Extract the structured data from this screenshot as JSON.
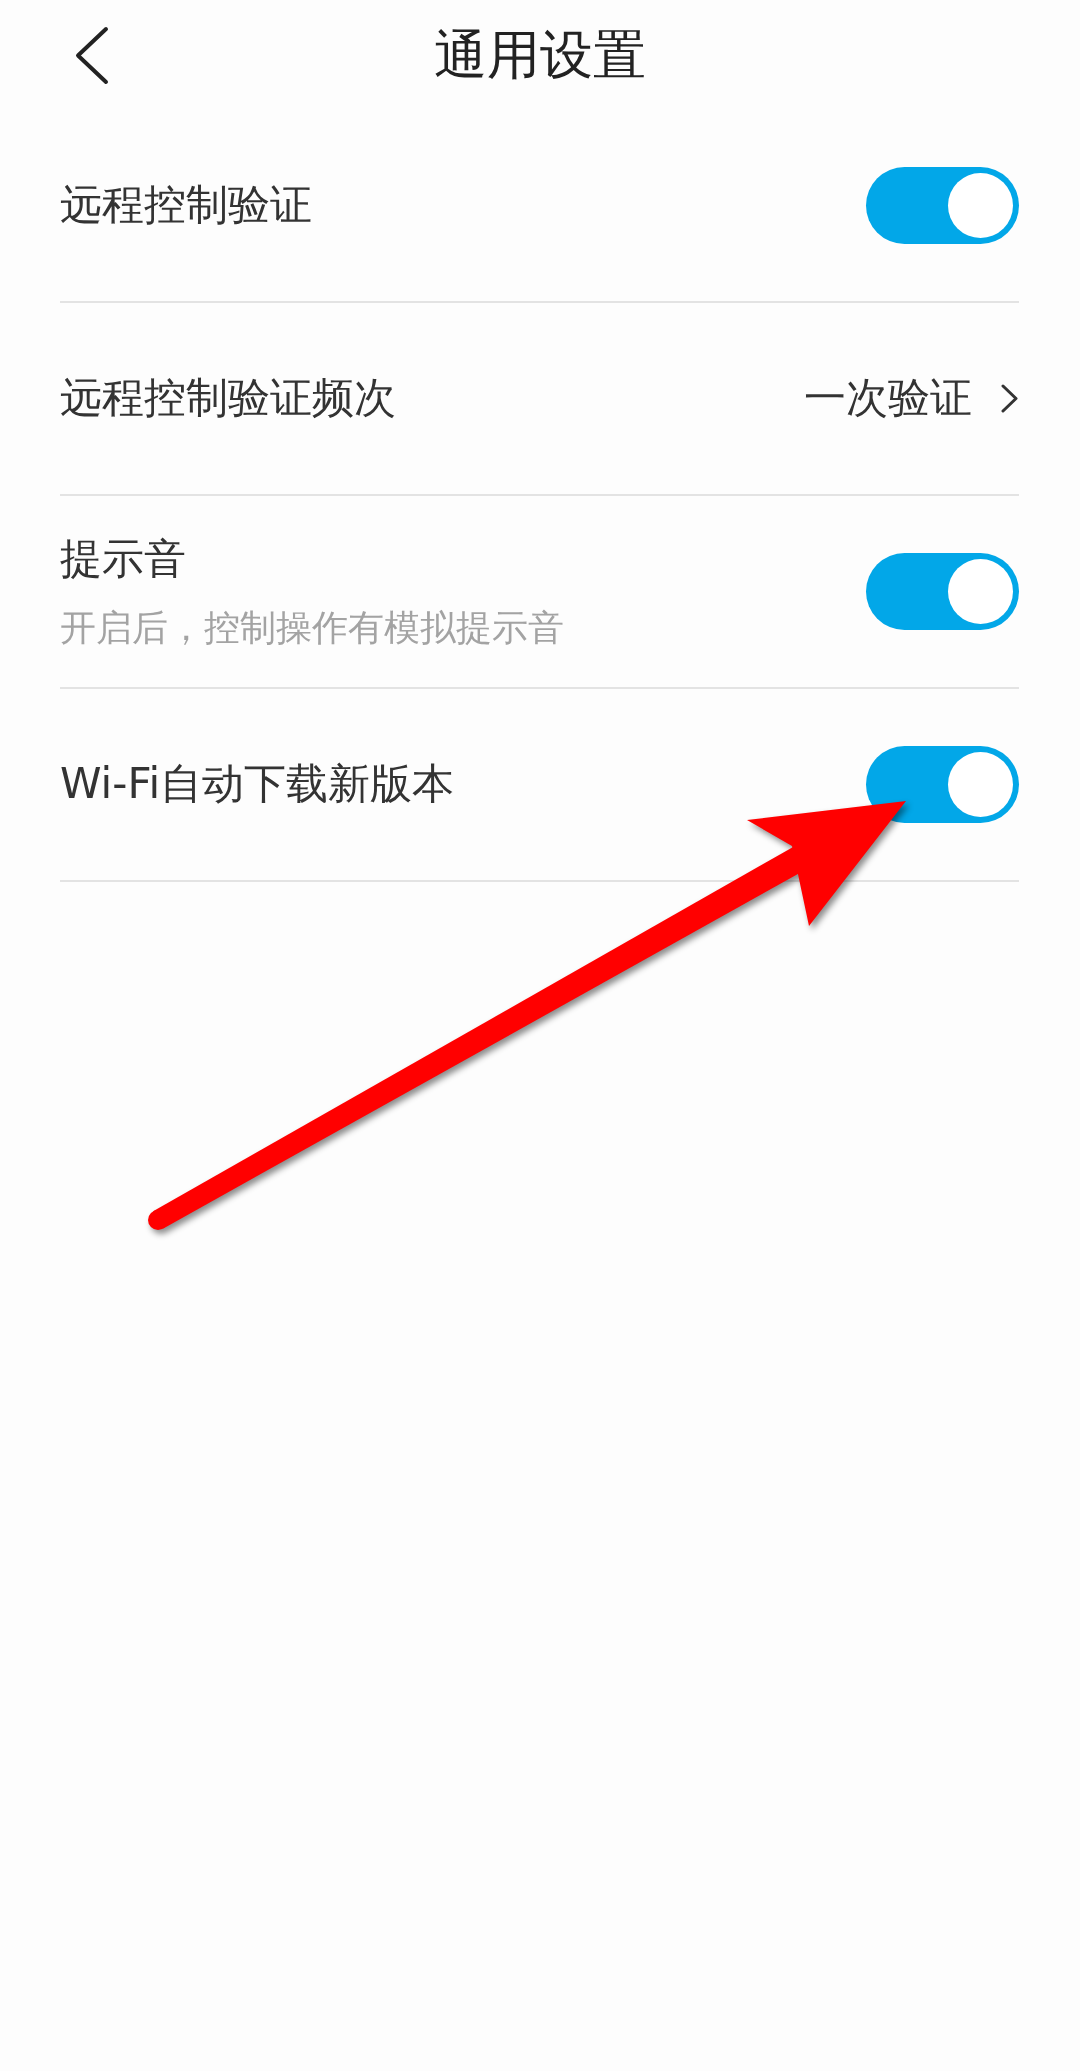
{
  "header": {
    "title": "通用设置"
  },
  "settings": [
    {
      "kind": "toggle",
      "label": "远程控制验证",
      "on": true
    },
    {
      "kind": "link",
      "label": "远程控制验证频次",
      "value": "一次验证"
    },
    {
      "kind": "toggle",
      "label": "提示音",
      "description": "开启后，控制操作有模拟提示音",
      "on": true
    },
    {
      "kind": "toggle",
      "label": "Wi-Fi自动下载新版本",
      "on": true
    }
  ],
  "annotations": [
    {
      "kind": "arrow"
    }
  ]
}
